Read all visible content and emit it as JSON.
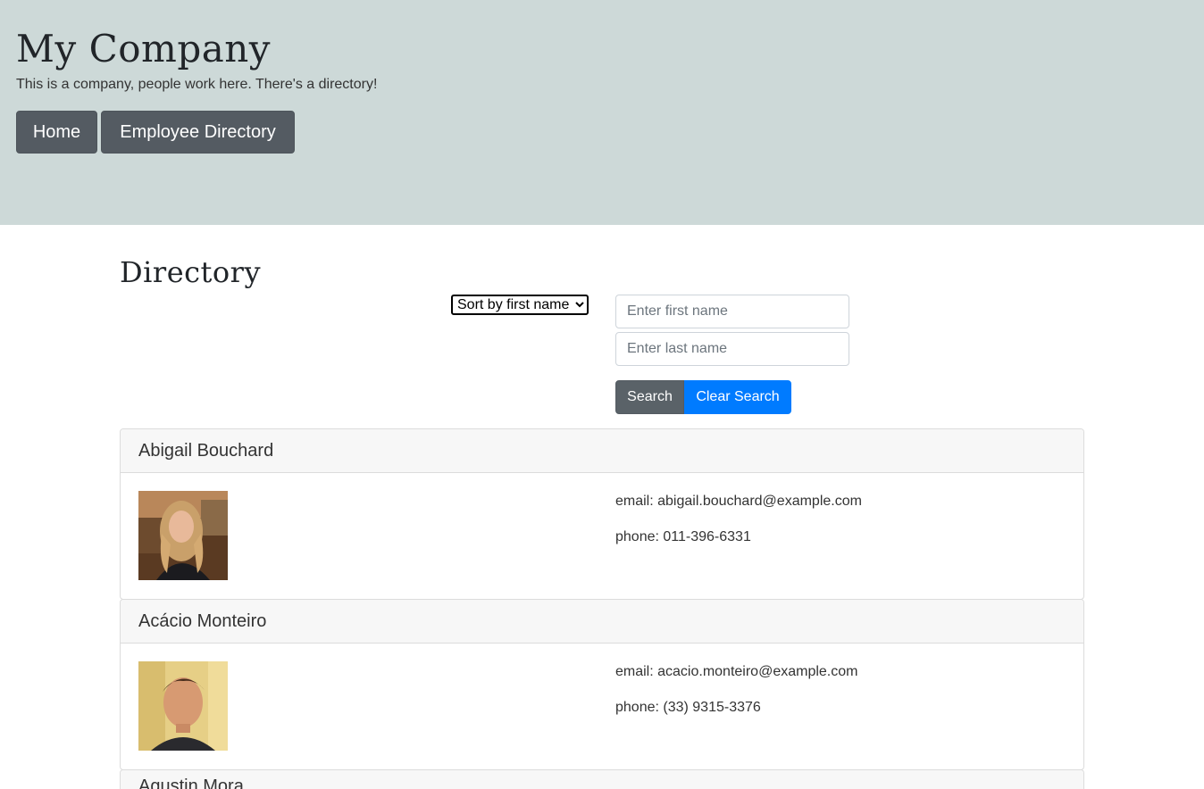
{
  "header": {
    "title": "My Company",
    "tagline": "This is a company, people work here. There's a directory!",
    "nav": [
      {
        "label": "Home"
      },
      {
        "label": "Employee Directory"
      }
    ]
  },
  "directory": {
    "title": "Directory",
    "sort": {
      "selected": "Sort by first name",
      "options": [
        "Sort by first name"
      ]
    },
    "search": {
      "first_placeholder": "Enter first name",
      "last_placeholder": "Enter last name",
      "search_label": "Search",
      "clear_label": "Clear Search"
    },
    "employees": [
      {
        "name": "Abigail Bouchard",
        "email": "email: abigail.bouchard@example.com",
        "phone": "phone: 011-396-6331"
      },
      {
        "name": "Acácio Monteiro",
        "email": "email: acacio.monteiro@example.com",
        "phone": "phone: (33) 9315-3376"
      },
      {
        "name": "Agustin Mora"
      }
    ]
  },
  "colors": {
    "header_bg": "#cdd9d8",
    "nav_button": "#545b62",
    "search_button": "#5a6268",
    "clear_button": "#007bff"
  }
}
